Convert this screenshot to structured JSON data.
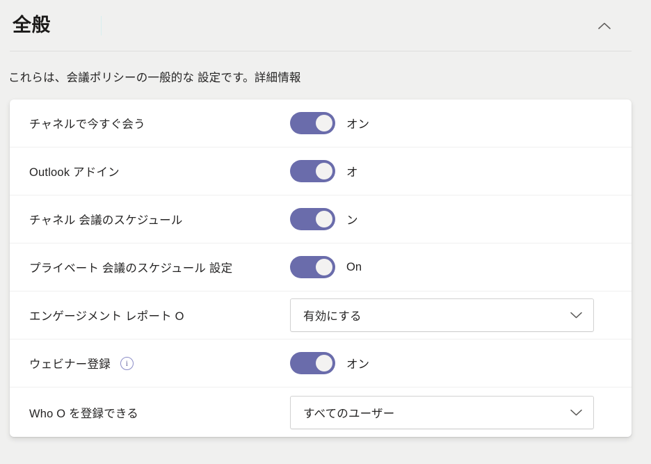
{
  "header": {
    "title": "全般",
    "collapse_icon": "chevron-up-icon"
  },
  "description": "これらは、会議ポリシーの一般的な 設定です。詳細情報",
  "settings": [
    {
      "label": "チャネルで今すぐ会う",
      "control": "toggle",
      "state": "on",
      "state_label": "オン",
      "has_info": false
    },
    {
      "label": "Outlook アドイン",
      "control": "toggle",
      "state": "on",
      "state_label": "オ",
      "has_info": false
    },
    {
      "label": "チャネル 会議のスケジュール",
      "control": "toggle",
      "state": "on",
      "state_label": "ン",
      "has_info": false
    },
    {
      "label": "プライベート 会議のスケジュール 設定",
      "control": "toggle",
      "state": "on",
      "state_label": "On",
      "has_info": false
    },
    {
      "label": "エンゲージメント レポート O",
      "control": "dropdown",
      "value": "有効にする",
      "has_info": false
    },
    {
      "label": "ウェビナー登録",
      "control": "toggle",
      "state": "on",
      "state_label": "オン",
      "has_info": true,
      "info_icon": "info-circle-icon",
      "info_glyph": "i"
    },
    {
      "label": "Who O を登録できる",
      "control": "dropdown",
      "value": "すべてのユーザー",
      "has_info": false
    }
  ],
  "colors": {
    "page_background": "#f0f0ef",
    "card_background": "#ffffff",
    "toggle_on": "#6a6cab",
    "toggle_knob": "#f3f2f1",
    "text": "#252424",
    "divider": "#f0f0f0",
    "info_accent": "#8b8cc7"
  }
}
